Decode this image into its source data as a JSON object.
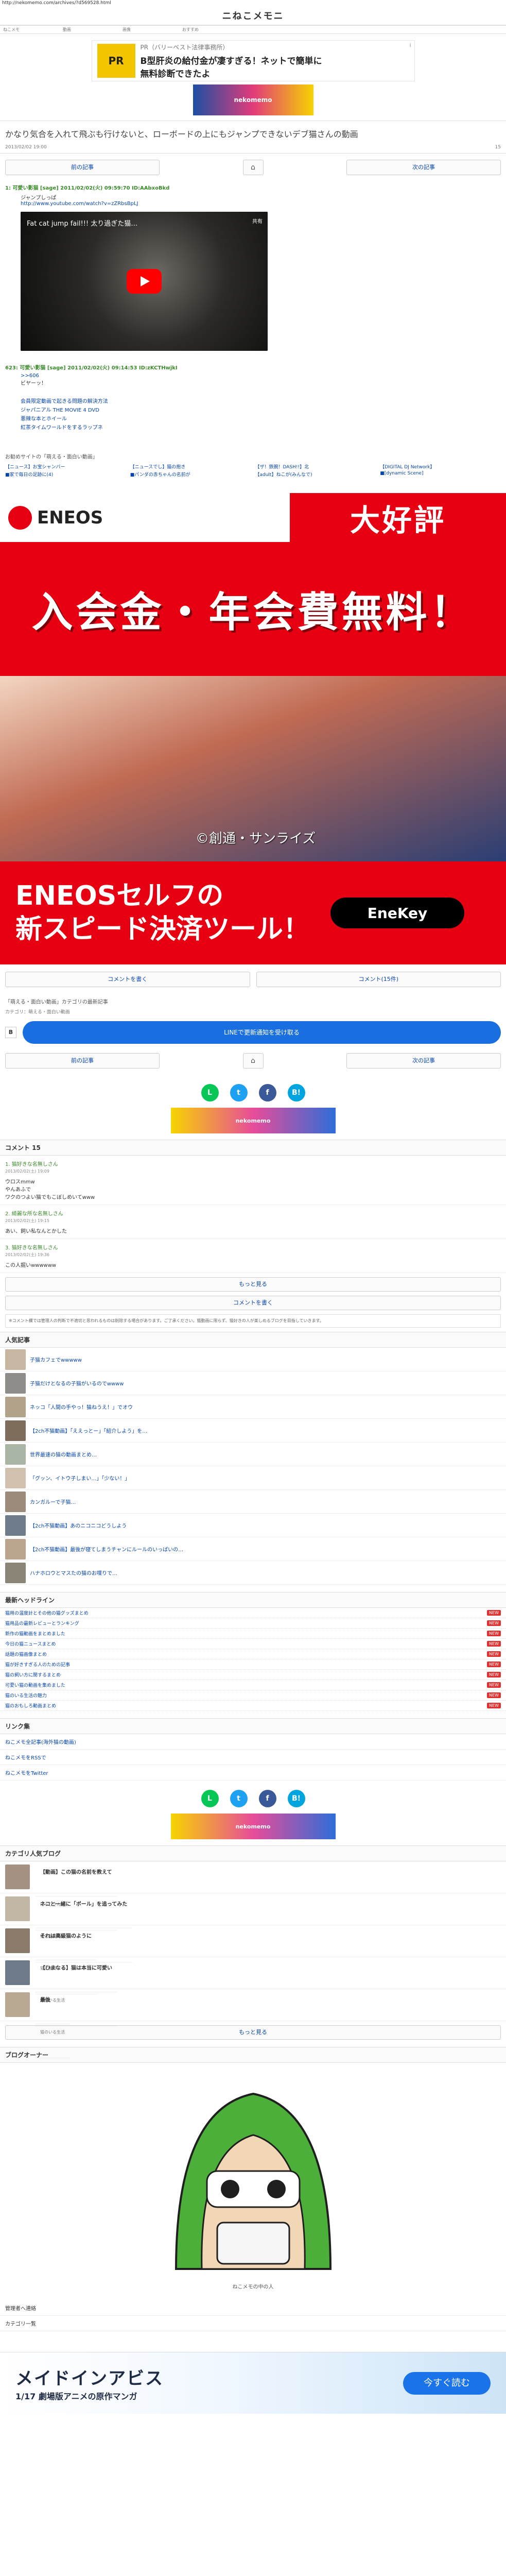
{
  "browser_url": "http://nekomemo.com/archives/?d569528.html",
  "site": {
    "title": "ニねこメモニ"
  },
  "ad_top": {
    "title_small": "PR（バリーベスト法律事務所）",
    "line1": "B型肝炎の給付金が凄すぎる！ネットで簡単に",
    "line2": "無料診断できたよ",
    "info_label": "i"
  },
  "post": {
    "title": "かなり気合を入れて飛ぶも行けないと、ローボードの上にもジャンプできないデブ猫さんの動画",
    "date": "2013/02/02 19:00",
    "comment_count": "15"
  },
  "pager": {
    "prev": "前の記事",
    "home": "⌂",
    "next": "次の記事"
  },
  "res1": {
    "header": "1: 可愛い影猫 [sage] 2011/02/02(火) 09:59:70 ID:AAbxoBkd",
    "body": "ジャンプしっぱ",
    "link": "http://www.youtube.com/watch?v=zZRbsBpLJ"
  },
  "video": {
    "title": "Fat cat jump fail!!! 太り過ぎた猫…",
    "share": "共有"
  },
  "res2": {
    "header": "623: 可愛い影猫 [sage] 2011/02/02(火) 09:14:53 ID:zKCTHwjkI",
    "body_link": ">>606",
    "body": "ビヤーッ！"
  },
  "links": [
    "会員限定動画で起きる問題の解決方法",
    "ジャパニアル THE MOVIE 4 DVD",
    "悪辣な本とホイール",
    "紅茶タイムワールドをするラップネ"
  ],
  "related_title": "お勧めサイトの「萌える・面白い動画」",
  "related": [
    "【ニュース】お宝シャンバー",
    "【ニュースでし】猫の抱き",
    "【ザ！鉄腕！DASH!!】北",
    "【DIGITAL DJ Network】",
    "■家で毎日の足跡に(4)",
    "■パンダの赤ちゃんの名前が",
    "【adult】ねこが(みんなで)",
    "■[dynamic Scene]"
  ],
  "eneos_ad": {
    "brand": "ENEOS",
    "top_right": "大好評",
    "headline": "入会金・年会費無料！",
    "copyright": "©創通・サンライズ",
    "bottom_line1": "ENEOSセルフの",
    "bottom_line2": "新スピード決済ツール！",
    "key_name": "EneKey"
  },
  "actions": {
    "comment": "コメントを書く",
    "comment_count": "コメント(15件)"
  },
  "category": {
    "text": "「萌える・面白い動画」カテゴリの最新記事",
    "sub": "カテゴリ：萌える・面白い動画"
  },
  "line_button": "LINEで更新通知を受け取る",
  "social": {
    "line": "L",
    "twitter": "t",
    "facebook": "f",
    "hatena": "B!"
  },
  "comments_head": "コメント 15",
  "comments": [
    {
      "name": "1. 猫好きな名無しさん",
      "date": "2013/02/02(土) 19:09",
      "body": "ウロスmmw\nやんあふで\nワクのつよい猫でもこぼしめいてwww"
    },
    {
      "name": "2. 綺麗な所な名無しさん",
      "date": "2013/02/02(土) 19:15",
      "body": "あい、飼い私なんとかした"
    },
    {
      "name": "3. 猫好きな名無しさん",
      "date": "2013/02/02(土) 19:36",
      "body": "この人掘いwwwwww"
    }
  ],
  "more_button": "もっと見る",
  "write_comment": "コメントを書く",
  "note": "※コメント欄では管理人の判断で不適切と思われるものは削除する場合があります。ご了承ください。猫動画に限らず、猫好きの人が楽しめるブログを目指していきます。",
  "popular_head": "人気記事",
  "popular": [
    "子猫カフェでwwwww",
    "子猫だけとなるの子猫がいるのでwwww",
    "ネッコ「人間の手やっ！猫ねうえ！」でオウ",
    "【2ch不猫動画】「ええっとー」「紹介しよう」を…",
    "世界最速の猫の動画まとめ…",
    "「グッン、イトウ子しまい…」「少ない！」",
    "カンガルーで子猫…",
    "【2ch不猫動画】あのニコニコどうしよう",
    "【2ch不猫動画】最後が寝てしまうチャンにルールのいっぱいの…",
    "ハナホロウとマスたの猫のお喋りで…"
  ],
  "headline_head": "最新ヘッドライン",
  "headlines": [
    "猫用の温度計とその他の猫グッズまとめ",
    "猫用品の最新レビューとランキング",
    "新作の猫動画をまとめました",
    "今日の猫ニュースまとめ",
    "話題の猫画像まとめ",
    "猫が好きすぎる人のための記事",
    "猫の飼い方に関するまとめ",
    "可愛い猫の動画を集めました",
    "猫のいる生活の魅力",
    "猫のおもしろ動画まとめ"
  ],
  "headline_new": "NEW",
  "link_head": "リンク集",
  "link_list": [
    "ねこメモ全記事(海外猫の動画)",
    "ねこメモをRSSで",
    "ねこメモをTwitter"
  ],
  "cat_head": "カテゴリ人気ブログ",
  "cat_articles": [
    {
      "title": "【動画】この猫の名前を教えて",
      "sub": "にゃこさんを"
    },
    {
      "title": "ネコと一緒に「ボール」を追ってみた",
      "sub": "猫と動物の話"
    },
    {
      "title": "それは高級猫のように",
      "sub": "猫と動物"
    },
    {
      "title": "【ひまなる】猫は本当に可愛い",
      "sub": "猫のいる生活"
    },
    {
      "title": "最後",
      "sub": "猫のいる生活"
    }
  ],
  "blog_owner_head": "ブログオーナー",
  "profile_caption": "ねこメモの中の人",
  "footer_links": [
    "管理者へ連絡",
    "カテゴリ一覧"
  ],
  "bottom_ad": {
    "title": "メイドインアビス",
    "sub": "1/17 劇場版アニメの原作マンガ",
    "cta": "今すぐ読む"
  }
}
